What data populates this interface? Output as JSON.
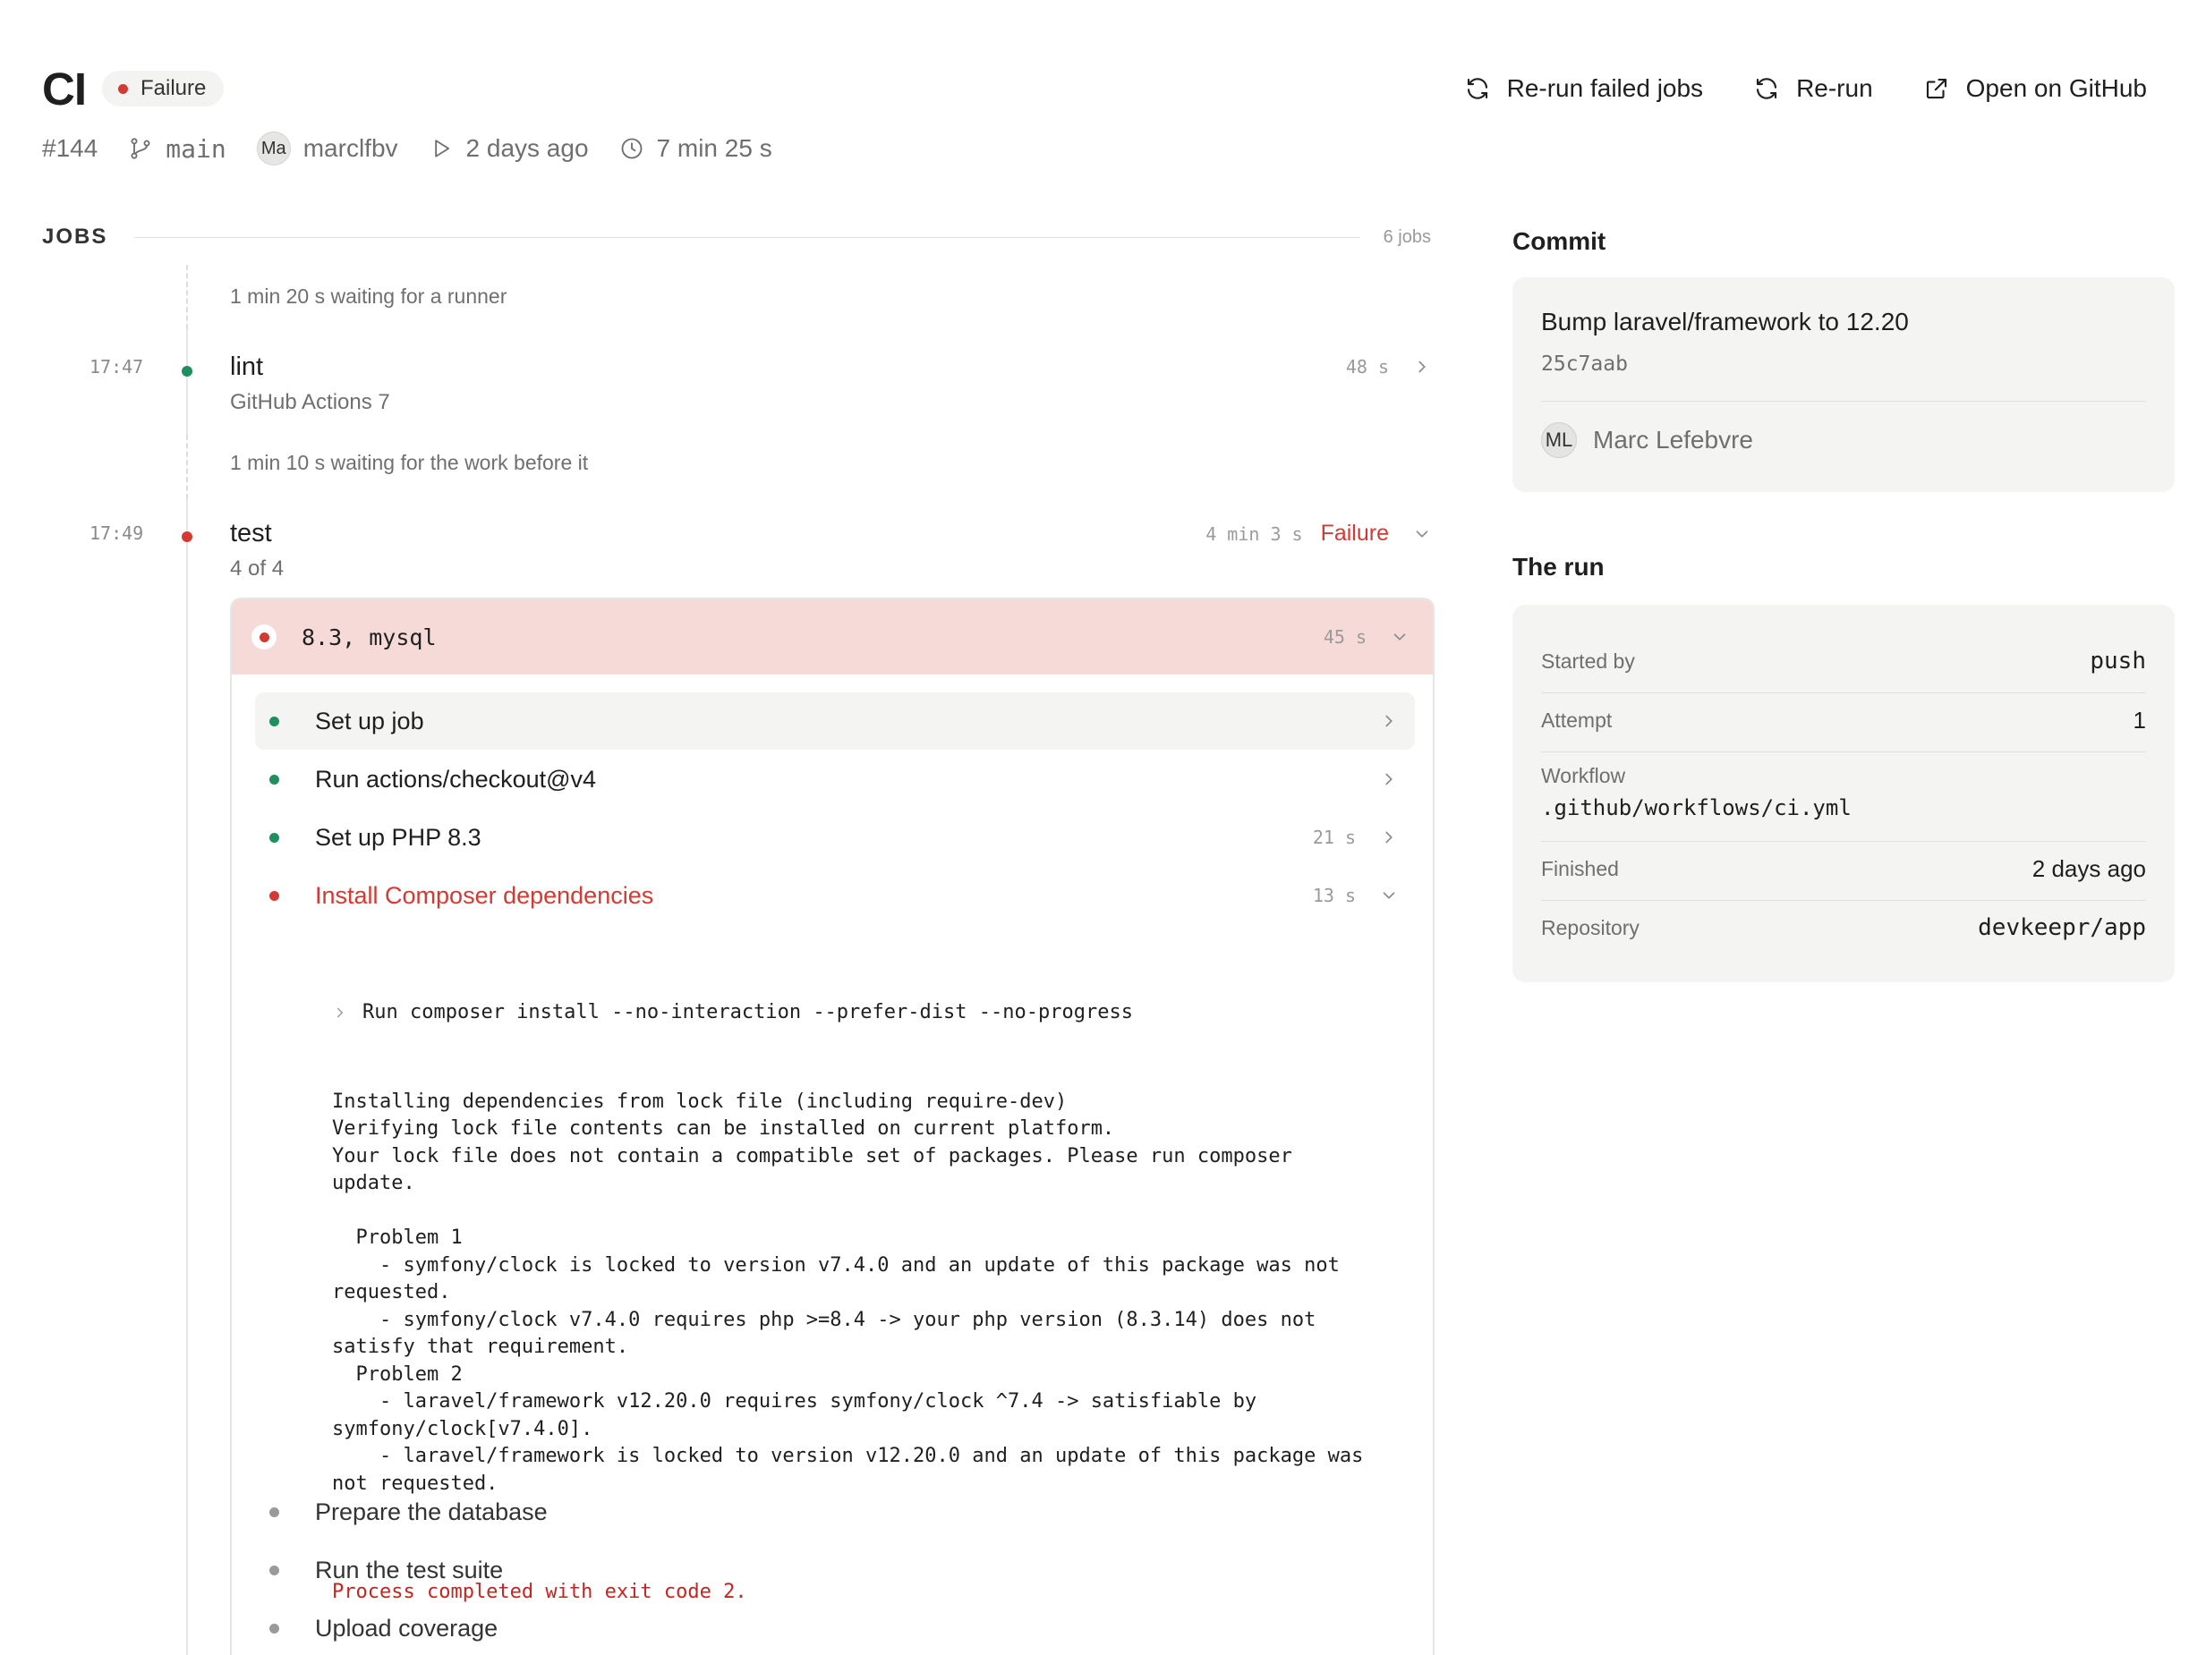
{
  "workflow": {
    "title": "CI",
    "status": "Failure",
    "run_number": "#144",
    "branch": "main",
    "actor_initials": "Ma",
    "actor": "marclfbv",
    "started": "2 days ago",
    "duration": "7 min 25 s"
  },
  "actions": {
    "rerun_failed": "Re-run failed jobs",
    "rerun": "Re-run",
    "open_github": "Open on GitHub"
  },
  "jobs": {
    "label": "JOBS",
    "count": "6 jobs",
    "wait1": "1 min 20 s waiting for a runner",
    "wait2": "1 min 10 s waiting for the work before it",
    "items": [
      {
        "time": "17:47",
        "name": "lint",
        "sub": "GitHub Actions 7",
        "duration": "48 s",
        "status": "success"
      },
      {
        "time": "17:49",
        "name": "test",
        "sub": "4 of 4",
        "duration": "4 min 3 s",
        "status": "Failure"
      }
    ]
  },
  "matrix": {
    "title": "8.3, mysql",
    "duration": "45 s",
    "steps": [
      {
        "name": "Set up job",
        "duration": "",
        "status": "success"
      },
      {
        "name": "Run actions/checkout@v4",
        "duration": "",
        "status": "success"
      },
      {
        "name": "Set up PHP 8.3",
        "duration": "21 s",
        "status": "success"
      },
      {
        "name": "Install Composer dependencies",
        "duration": "13 s",
        "status": "failure"
      },
      {
        "name": "Prepare the database",
        "duration": "",
        "status": "pending"
      },
      {
        "name": "Run the test suite",
        "duration": "",
        "status": "pending"
      },
      {
        "name": "Upload coverage",
        "duration": "",
        "status": "pending"
      }
    ]
  },
  "log": {
    "command": "Run composer install --no-interaction --prefer-dist --no-progress",
    "body": "Installing dependencies from lock file (including require-dev)\nVerifying lock file contents can be installed on current platform.\nYour lock file does not contain a compatible set of packages. Please run composer\nupdate.\n\n  Problem 1\n    - symfony/clock is locked to version v7.4.0 and an update of this package was not\nrequested.\n    - symfony/clock v7.4.0 requires php >=8.4 -> your php version (8.3.14) does not\nsatisfy that requirement.\n  Problem 2\n    - laravel/framework v12.20.0 requires symfony/clock ^7.4 -> satisfiable by\nsymfony/clock[v7.4.0].\n    - laravel/framework is locked to version v12.20.0 and an update of this package was\nnot requested.",
    "exit": "Process completed with exit code 2."
  },
  "commit": {
    "heading": "Commit",
    "message": "Bump laravel/framework to 12.20",
    "sha": "25c7aab",
    "author_initials": "ML",
    "author": "Marc Lefebvre"
  },
  "run": {
    "heading": "The run",
    "started_by_label": "Started by",
    "started_by": "push",
    "attempt_label": "Attempt",
    "attempt": "1",
    "workflow_label": "Workflow",
    "workflow": ".github/workflows/ci.yml",
    "finished_label": "Finished",
    "finished": "2 days ago",
    "repository_label": "Repository",
    "repository": "devkeepr/app"
  },
  "colors": {
    "failure": "#d23a33",
    "success": "#1f8f5f",
    "pending": "#9a9a9a",
    "failure_bg": "#f6dad8"
  },
  "icons": [
    "refresh-icon",
    "external-link-icon",
    "branch-icon",
    "play-icon",
    "clock-icon",
    "chevron-right-icon",
    "chevron-down-icon"
  ]
}
